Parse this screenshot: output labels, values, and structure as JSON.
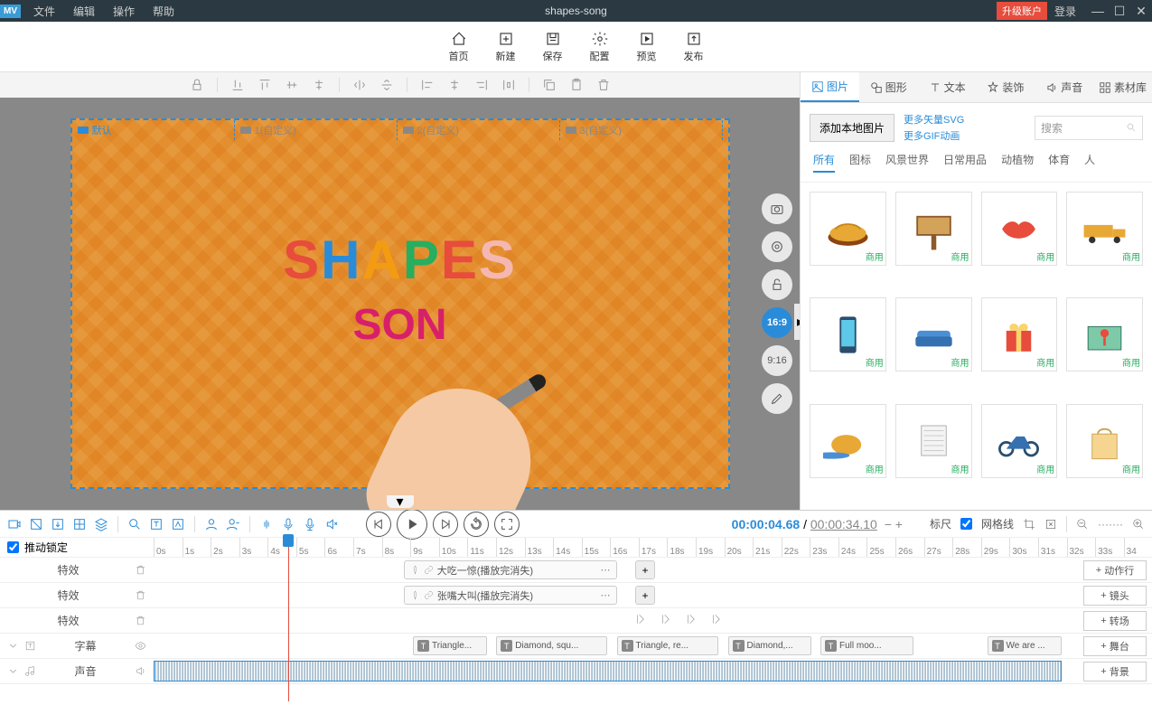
{
  "titlebar": {
    "logo": "MV",
    "menus": [
      "文件",
      "编辑",
      "操作",
      "帮助"
    ],
    "title": "shapes-song",
    "upgrade": "升级账户",
    "login": "登录"
  },
  "topToolbar": [
    {
      "id": "home",
      "label": "首页"
    },
    {
      "id": "new",
      "label": "新建"
    },
    {
      "id": "save",
      "label": "保存"
    },
    {
      "id": "config",
      "label": "配置"
    },
    {
      "id": "preview",
      "label": "预览"
    },
    {
      "id": "publish",
      "label": "发布"
    }
  ],
  "scenes": [
    {
      "label": "默认",
      "active": true
    },
    {
      "label": "1(自定义)",
      "active": false
    },
    {
      "label": "2(自定义)",
      "active": false
    },
    {
      "label": "3(自定义)",
      "active": false
    }
  ],
  "canvasText": {
    "line1": "SHAPES",
    "line2": "SON"
  },
  "aspectRatios": [
    {
      "label": "16:9",
      "active": true
    },
    {
      "label": "9:16",
      "active": false
    }
  ],
  "rightPanel": {
    "tabs": [
      {
        "id": "image",
        "label": "图片",
        "active": true
      },
      {
        "id": "shape",
        "label": "图形"
      },
      {
        "id": "text",
        "label": "文本"
      },
      {
        "id": "decoration",
        "label": "装饰"
      },
      {
        "id": "sound",
        "label": "声音"
      },
      {
        "id": "library",
        "label": "素材库"
      }
    ],
    "addLocal": "添加本地图片",
    "svgLink1": "更多矢量SVG",
    "svgLink2": "更多GIF动画",
    "searchPlaceholder": "搜索",
    "categories": [
      {
        "label": "所有",
        "active": true
      },
      {
        "label": "图标"
      },
      {
        "label": "风景世界"
      },
      {
        "label": "日常用品"
      },
      {
        "label": "动植物"
      },
      {
        "label": "体育"
      },
      {
        "label": "人"
      }
    ],
    "badge": "商用"
  },
  "timeline": {
    "lockScroll": "推动锁定",
    "currentTime": "00:00:04.68",
    "totalTime": "00:00:34.10",
    "rulerLabel": "标尺",
    "gridLabel": "网格线",
    "ticks": [
      "0s",
      "1s",
      "2s",
      "3s",
      "4s",
      "5s",
      "6s",
      "7s",
      "8s",
      "9s",
      "10s",
      "11s",
      "12s",
      "13s",
      "14s",
      "15s",
      "16s",
      "17s",
      "18s",
      "19s",
      "20s",
      "21s",
      "22s",
      "23s",
      "24s",
      "25s",
      "26s",
      "27s",
      "28s",
      "29s",
      "30s",
      "31s",
      "32s",
      "33s",
      "34"
    ],
    "trackLabels": {
      "effect": "特效",
      "subtitle": "字幕",
      "sound": "声音"
    },
    "clips": {
      "effect1": "大吃一惊(播放完消失)",
      "effect2": "张嘴大叫(播放完消失)"
    },
    "subtitles": [
      "Triangle...",
      "Diamond, squ...",
      "Triangle, re...",
      "Diamond,...",
      "Full moo...",
      "We are ..."
    ],
    "addButtons": {
      "action": "动作行",
      "camera": "镜头",
      "transition": "转场",
      "stage": "舞台",
      "background": "背景"
    }
  }
}
